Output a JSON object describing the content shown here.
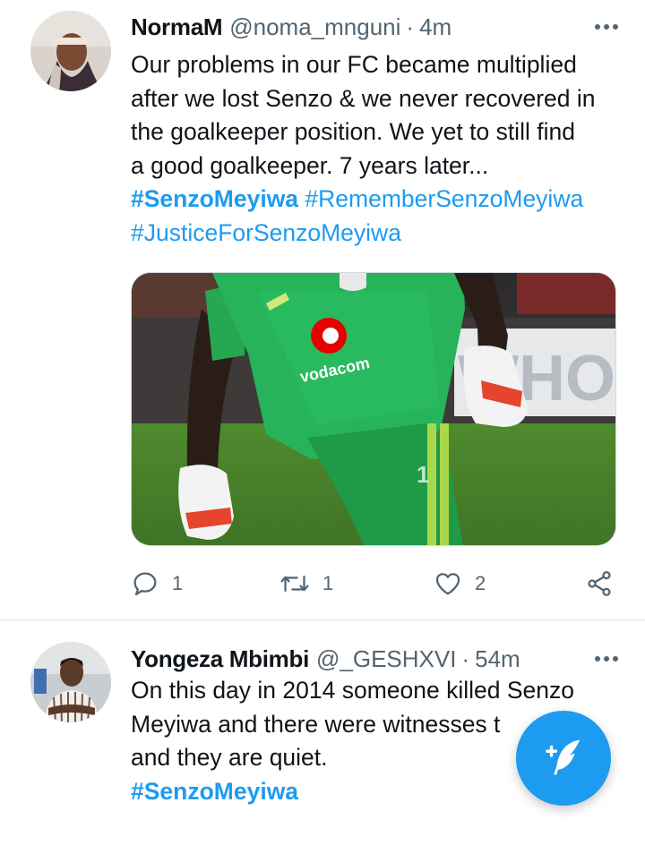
{
  "tweets": [
    {
      "name": "NormaM",
      "handle": "@noma_mnguni",
      "separator": "·",
      "time": "4m",
      "lines": [
        "Our problems in our FC became multiplied",
        "after we lost Senzo & we never recovered in",
        "the goalkeeper position. We yet to still find",
        "a good goalkeeper. 7 years later..."
      ],
      "hashtags_line1": [
        "#SenzoMeyiwa",
        "#RememberSenzoMeyiwa"
      ],
      "hashtags_line2": [
        "#JusticeForSenzoMeyiwa"
      ],
      "media": {
        "jersey_brand": "vodacom",
        "background_text": "WHO",
        "shorts_number": "1"
      },
      "actions": {
        "replies": "1",
        "retweets": "1",
        "likes": "2"
      }
    },
    {
      "name": "Yongeza Mbimbi",
      "handle": "@_GESHXVI",
      "separator": "·",
      "time": "54m",
      "lines": [
        "On this day in 2014 someone killed Senzo",
        "Meyiwa and there were witnesses t",
        "and they are quiet."
      ],
      "hashtags_line1": [
        "#SenzoMeyiwa"
      ]
    }
  ],
  "icons": {
    "more": "more-horizontal-icon",
    "reply": "reply-icon",
    "retweet": "retweet-icon",
    "like": "heart-icon",
    "share": "share-icon",
    "compose": "compose-tweet-icon"
  },
  "colors": {
    "accent": "#1d9bf0",
    "text": "#0f1419",
    "secondary": "#536471",
    "divider": "#eff3f4"
  }
}
